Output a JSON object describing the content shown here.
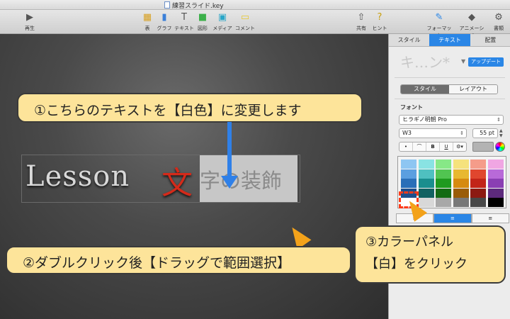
{
  "window": {
    "title": "練習スライド.key"
  },
  "toolbar": {
    "left": [
      {
        "label": "再生",
        "icon": "play-icon"
      }
    ],
    "center": [
      {
        "label": "表",
        "icon": "table-icon"
      },
      {
        "label": "グラフ",
        "icon": "chart-icon"
      },
      {
        "label": "テキスト",
        "icon": "text-icon"
      },
      {
        "label": "図形",
        "icon": "shape-icon"
      },
      {
        "label": "メディア",
        "icon": "media-icon"
      },
      {
        "label": "コメント",
        "icon": "comment-icon"
      }
    ],
    "right": [
      {
        "label": "共有",
        "icon": "share-icon"
      },
      {
        "label": "ヒント",
        "icon": "tips-icon"
      },
      {
        "label": "フォーマット",
        "icon": "format-icon"
      },
      {
        "label": "アニメーション",
        "icon": "animation-icon"
      },
      {
        "label": "書類",
        "icon": "document-icon"
      }
    ]
  },
  "slide": {
    "word": "Lesson",
    "char_red": "文",
    "selected_text": "字の装飾"
  },
  "callouts": {
    "step1": "①こちらのテキストを【白色】に変更します",
    "step2": "②ダブルクリック後【ドラッグで範囲選択】",
    "step3_line1": "③カラーパネル",
    "step3_line2": "【白】をクリック"
  },
  "inspector": {
    "tabs": [
      "スタイル",
      "テキスト",
      "配置"
    ],
    "active_tab": 1,
    "style_preview": "キ…ン*",
    "update_label": "アップデート",
    "segments": [
      "スタイル",
      "レイアウト"
    ],
    "font_section": "フォント",
    "font_family": "ヒラギノ明朝 Pro",
    "font_weight": "W3",
    "font_size": "55 pt",
    "format_buttons": [
      "•",
      "⌒",
      "B",
      "U",
      "⚙▾"
    ],
    "current_color": "#b3b3b3"
  },
  "palette": {
    "rows": [
      [
        "#8ec6f2",
        "#89e3e3",
        "#87e887",
        "#f5e27c",
        "#f59c8a",
        "#f0a6e3"
      ],
      [
        "#5b9fe0",
        "#4fc0c0",
        "#51c451",
        "#e8b830",
        "#e0462e",
        "#b86ad8"
      ],
      [
        "#2a6fb8",
        "#1a8e8e",
        "#1f9a1f",
        "#d68a10",
        "#c22418",
        "#8a3fb3"
      ],
      [
        "#1d4f8c",
        "#126262",
        "#146b14",
        "#9a5c08",
        "#8c1a12",
        "#5c2a7c"
      ],
      [
        "#ffffff",
        "#d8d8d8",
        "#a8a8a8",
        "#787878",
        "#484848",
        "#000000"
      ]
    ]
  }
}
